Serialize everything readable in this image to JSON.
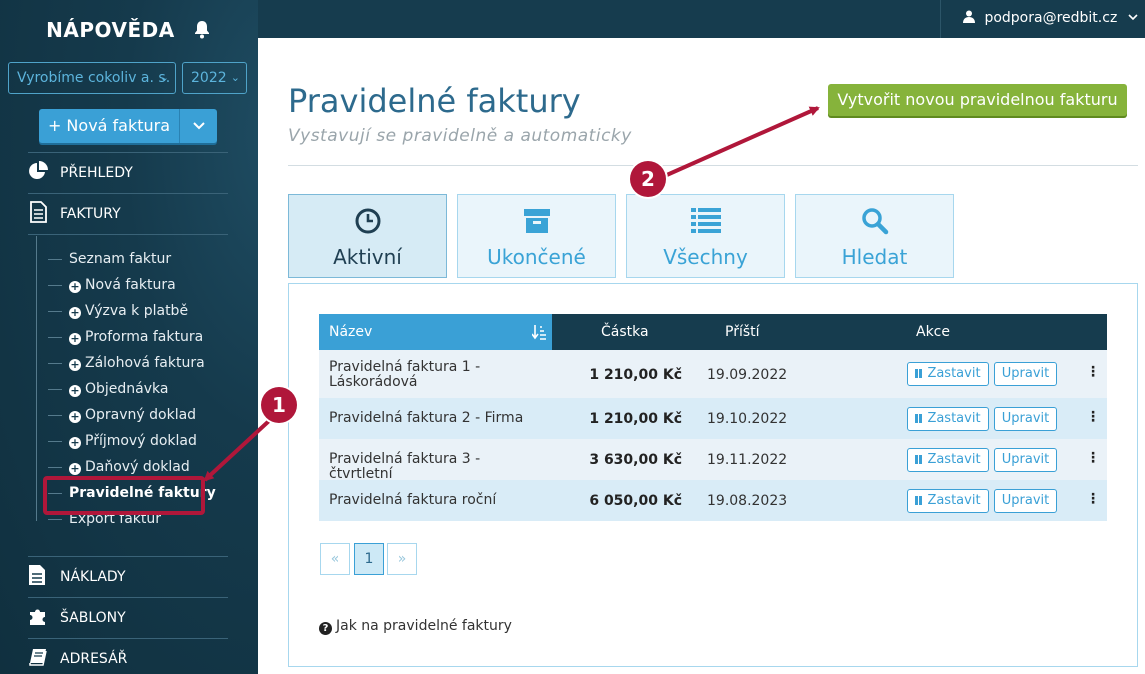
{
  "sidebar": {
    "title": "NÁPOVĚDA",
    "company_select": "Vyrobíme cokoliv a. s.",
    "year_select": "2022",
    "new_invoice_label": "+ Nová faktura",
    "sections": {
      "prehledy": "PŘEHLEDY",
      "faktury": "FAKTURY",
      "naklady": "NÁKLADY",
      "sablony": "ŠABLONY",
      "adresar": "ADRESÁŘ"
    },
    "items": [
      "Seznam faktur",
      "Nová faktura",
      "Výzva k platbě",
      "Proforma faktura",
      "Zálohová faktura",
      "Objednávka",
      "Opravný doklad",
      "Příjmový doklad",
      "Daňový doklad",
      "Pravidelné faktury",
      "Export faktur"
    ]
  },
  "topbar": {
    "user": "podpora@redbit.cz"
  },
  "main": {
    "title": "Pravidelné faktury",
    "subtitle": "Vystavují se pravidelně a automaticky",
    "create_button": "Vytvořit novou pravidelnou fakturu",
    "tabs": [
      "Aktivní",
      "Ukončené",
      "Všechny",
      "Hledat"
    ],
    "table": {
      "headers": {
        "name": "Název",
        "amount": "Částka",
        "next": "Příští",
        "actions": "Akce"
      },
      "rows": [
        {
          "name": "Pravidelná faktura 1 - Láskorádová",
          "amount": "1 210,00 Kč",
          "next": "19.09.2022"
        },
        {
          "name": "Pravidelná faktura 2 - Firma",
          "amount": "1 210,00 Kč",
          "next": "19.10.2022"
        },
        {
          "name": "Pravidelná faktura 3 - čtvrtletní",
          "amount": "3 630,00 Kč",
          "next": "19.11.2022"
        },
        {
          "name": "Pravidelná faktura roční",
          "amount": "6 050,00 Kč",
          "next": "19.08.2023"
        }
      ],
      "stop_label": "Zastavit",
      "edit_label": "Upravit"
    },
    "pagination": {
      "prev": "«",
      "current": "1",
      "next": "»"
    },
    "help_link": "Jak na pravidelné faktury"
  },
  "annotations": {
    "badge1": "1",
    "badge2": "2",
    "color": "#b0173a"
  }
}
